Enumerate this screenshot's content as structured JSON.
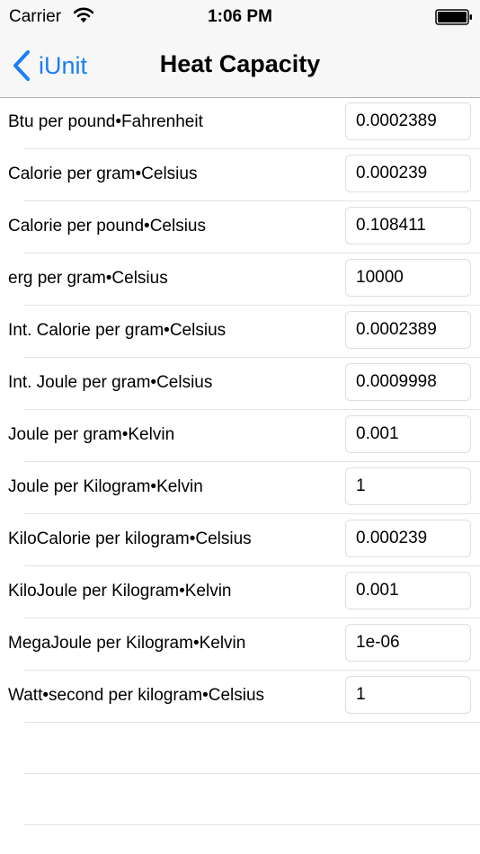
{
  "status_bar": {
    "carrier": "Carrier",
    "time": "1:06 PM"
  },
  "nav": {
    "back_label": "iUnit",
    "title": "Heat Capacity",
    "accent_color": "#1a7ef7"
  },
  "units": [
    {
      "label": "Btu per pound•Fahrenheit",
      "value": "0.0002389"
    },
    {
      "label": "Calorie per gram•Celsius",
      "value": "0.000239"
    },
    {
      "label": "Calorie per pound•Celsius",
      "value": "0.108411"
    },
    {
      "label": "erg per gram•Celsius",
      "value": "10000"
    },
    {
      "label": "Int. Calorie per gram•Celsius",
      "value": "0.0002389"
    },
    {
      "label": "Int. Joule per gram•Celsius",
      "value": "0.0009998"
    },
    {
      "label": "Joule per gram•Kelvin",
      "value": "0.001"
    },
    {
      "label": "Joule per Kilogram•Kelvin",
      "value": "1"
    },
    {
      "label": "KiloCalorie per kilogram•Celsius",
      "value": "0.000239"
    },
    {
      "label": "KiloJoule per Kilogram•Kelvin",
      "value": "0.001"
    },
    {
      "label": "MegaJoule per Kilogram•Kelvin",
      "value": "1e-06"
    },
    {
      "label": "Watt•second per kilogram•Celsius",
      "value": "1"
    }
  ]
}
